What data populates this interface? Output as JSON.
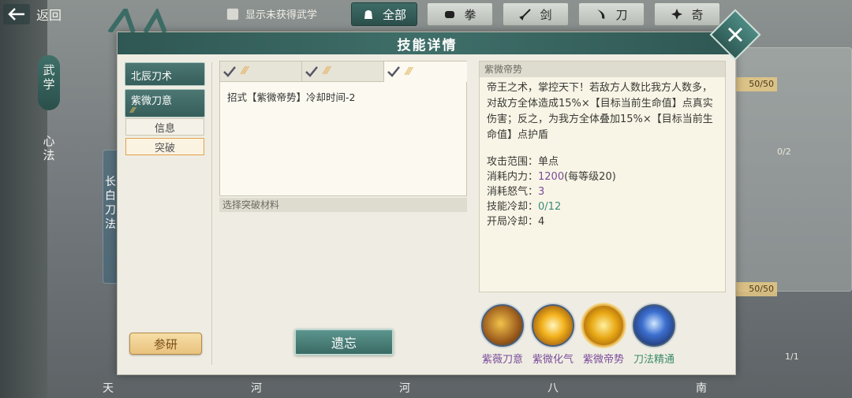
{
  "topbar": {
    "back_label": "返回",
    "toggle_label": "显示未获得武学",
    "tabs": [
      {
        "label": "全部",
        "icon": "bag-icon",
        "active": true
      },
      {
        "label": "拳",
        "icon": "fist-icon",
        "active": false
      },
      {
        "label": "剑",
        "icon": "sword-icon",
        "active": false
      },
      {
        "label": "刀",
        "icon": "blade-icon",
        "active": false
      },
      {
        "label": "奇",
        "icon": "shuriken-icon",
        "active": false
      }
    ]
  },
  "side_nav": {
    "wuxue": "武学",
    "xinfa": "心法"
  },
  "background": {
    "card_name": "长白刀法",
    "progress_top": "50/50",
    "progress_bottom": "50/50",
    "count_right": "0/2",
    "count_bottom": "1/1",
    "bottom_labels": [
      "天",
      "河",
      "河",
      "八",
      "南"
    ]
  },
  "modal": {
    "title": "技能详情",
    "left": {
      "skill_items": [
        "北辰刀术",
        "紫微刀意"
      ],
      "tabs": [
        "信息",
        "突破"
      ],
      "selected_tab": "突破",
      "research_label": "参研"
    },
    "middle": {
      "effect_text": "招式【紫微帝势】冷却时间-2",
      "materials_label": "选择突破材料",
      "forget_label": "遗忘"
    },
    "right": {
      "skill_name": "紫微帝势",
      "description": "帝王之术，掌控天下！若敌方人数比我方人数多，对敌方全体造成15%×【目标当前生命值】点真实伤害；反之，为我方全体叠加15%×【目标当前生命值】点护盾",
      "stats": [
        {
          "label": "攻击范围：",
          "value": "单点",
          "style": "normal"
        },
        {
          "label": "消耗内力：",
          "value": "1200",
          "suffix": "(每等级20)",
          "style": "purple"
        },
        {
          "label": "消耗怒气：",
          "value": "3",
          "style": "purple"
        },
        {
          "label": "技能冷却：",
          "value": "0/12",
          "style": "green"
        },
        {
          "label": "开局冷却：",
          "value": "4",
          "style": "normal"
        }
      ],
      "skills": [
        {
          "name": "紫薇刀意",
          "color": "purple"
        },
        {
          "name": "紫微化气",
          "color": "purple"
        },
        {
          "name": "紫微帝势",
          "color": "purple"
        },
        {
          "name": "刀法精通",
          "color": "green"
        }
      ]
    }
  },
  "colors": {
    "header_teal": "#3f6e69",
    "panel_bg": "#efede3",
    "purple_text": "#7a4a9a",
    "green_text": "#3b8a6a",
    "gold_button": "#e9c27e"
  }
}
